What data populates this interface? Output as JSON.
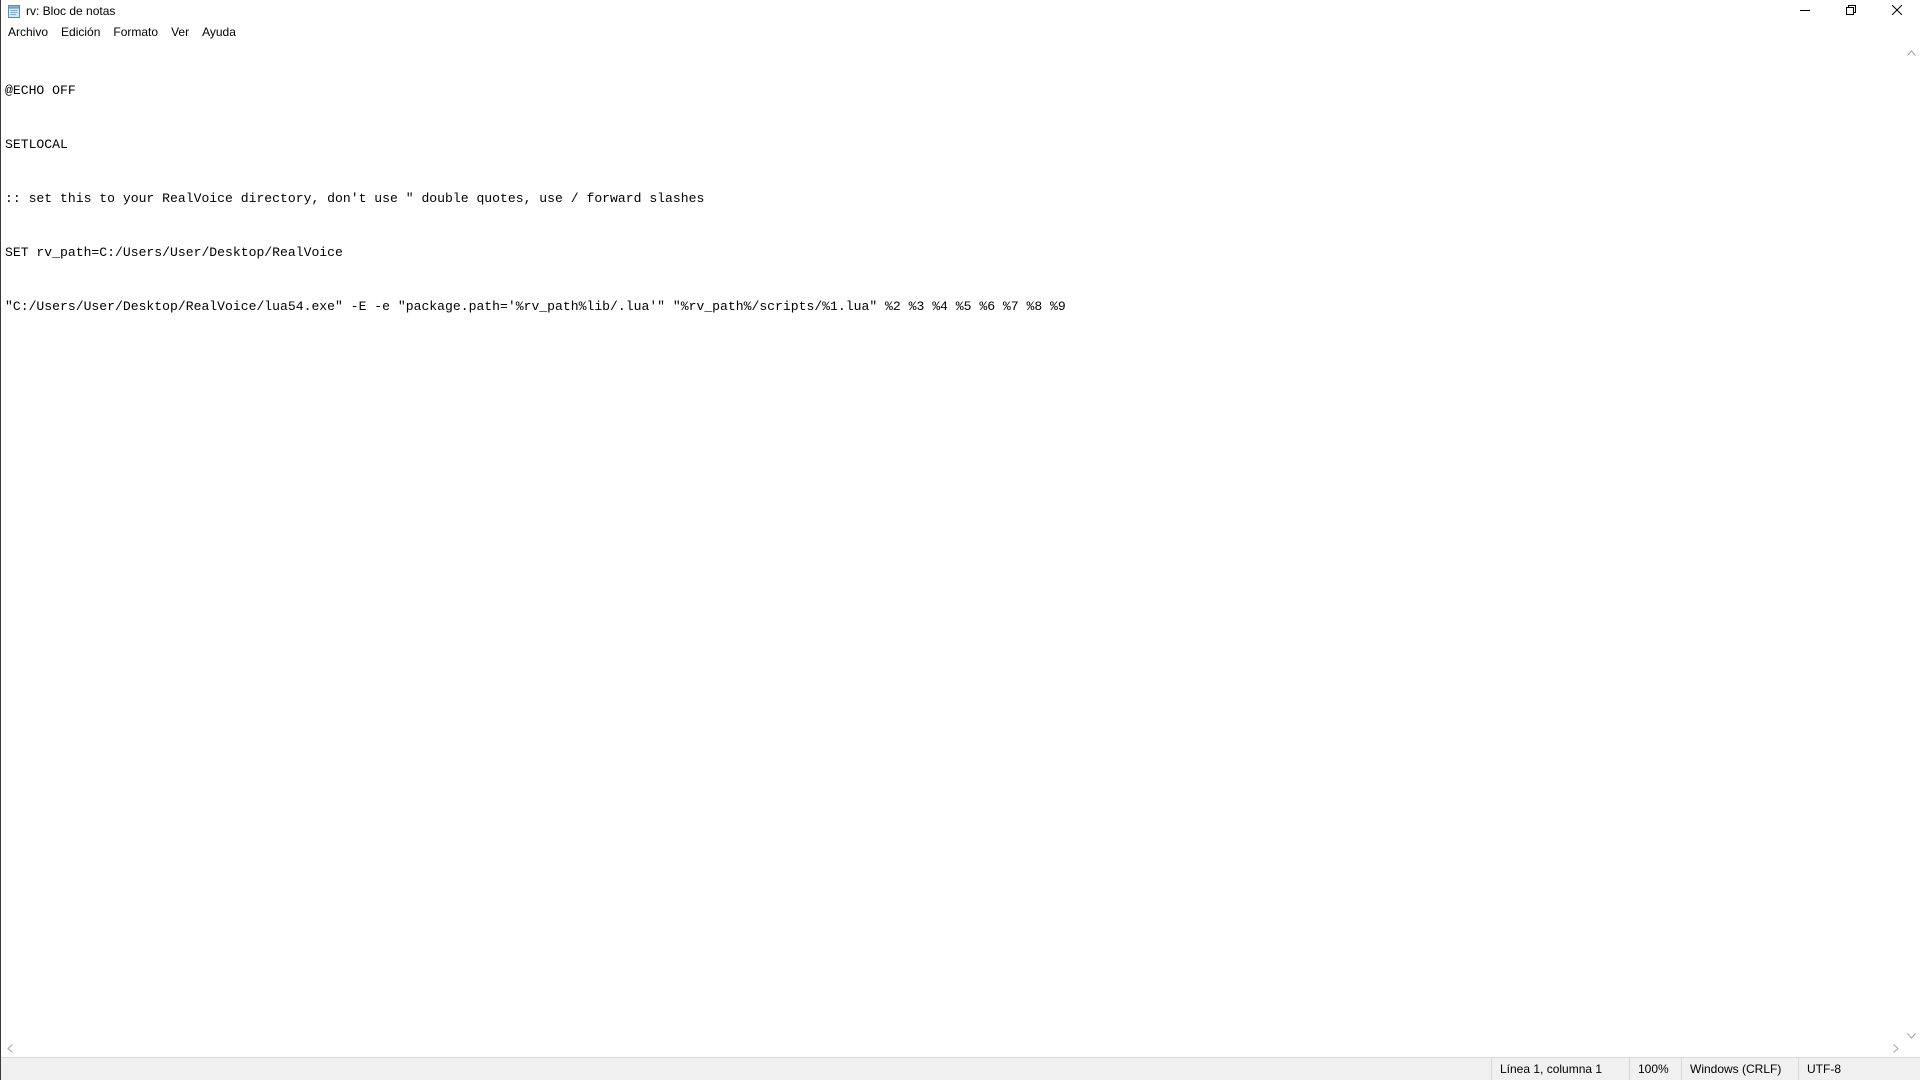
{
  "window": {
    "title": "rv: Bloc de notas",
    "app_icon": "notepad-icon",
    "controls": {
      "minimize_icon": "minimize-icon",
      "restore_icon": "restore-icon",
      "close_icon": "close-icon"
    }
  },
  "menu": {
    "items": [
      {
        "label": "Archivo"
      },
      {
        "label": "Edición"
      },
      {
        "label": "Formato"
      },
      {
        "label": "Ver"
      },
      {
        "label": "Ayuda"
      }
    ]
  },
  "editor": {
    "lines": [
      "@ECHO OFF",
      "SETLOCAL",
      ":: set this to your RealVoice directory, don't use \" double quotes, use / forward slashes",
      "SET rv_path=C:/Users/User/Desktop/RealVoice",
      "\"C:/Users/User/Desktop/RealVoice/lua54.exe\" -E -e \"package.path='%rv_path%lib/.lua'\" \"%rv_path%/scripts/%1.lua\" %2 %3 %4 %5 %6 %7 %8 %9"
    ]
  },
  "statusbar": {
    "position": "Línea 1, columna 1",
    "zoom": "100%",
    "line_ending": "Windows (CRLF)",
    "encoding": "UTF-8"
  }
}
